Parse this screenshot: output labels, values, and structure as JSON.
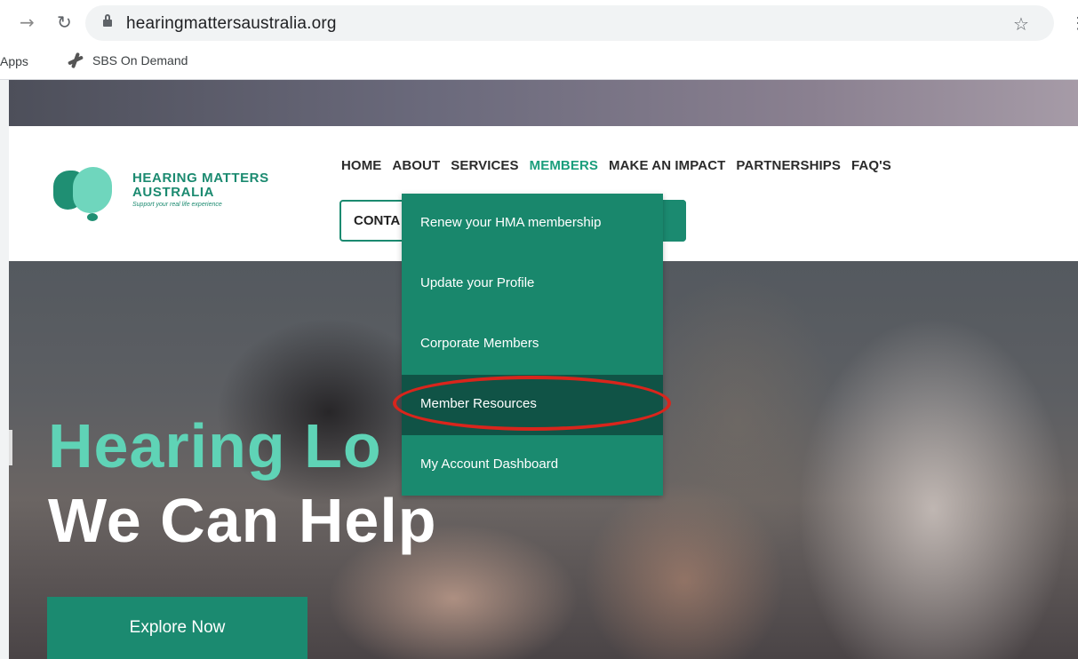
{
  "browser": {
    "url": "hearingmattersaustralia.org",
    "bookmarks": [
      "Apps",
      "SBS On Demand"
    ]
  },
  "site": {
    "logo_line1": "HEARING MATTERS",
    "logo_line2": "AUSTRALIA",
    "logo_tagline": "Support your real life experience",
    "nav": [
      "HOME",
      "ABOUT",
      "SERVICES",
      "MEMBERS",
      "MAKE AN IMPACT",
      "PARTNERSHIPS",
      "FAQ'S"
    ],
    "active_nav": "MEMBERS",
    "contact_label": "CONTA",
    "accent_color": "#1b8a70"
  },
  "dropdown": {
    "items": [
      "Renew your HMA membership",
      "Update your Profile",
      "Corporate Members",
      "Member Resources",
      "My Account Dashboard"
    ],
    "highlighted": "Member Resources"
  },
  "hero": {
    "title_line1": "Hearing Lo",
    "title_line2": "We Can Help",
    "cta": "Explore Now"
  }
}
